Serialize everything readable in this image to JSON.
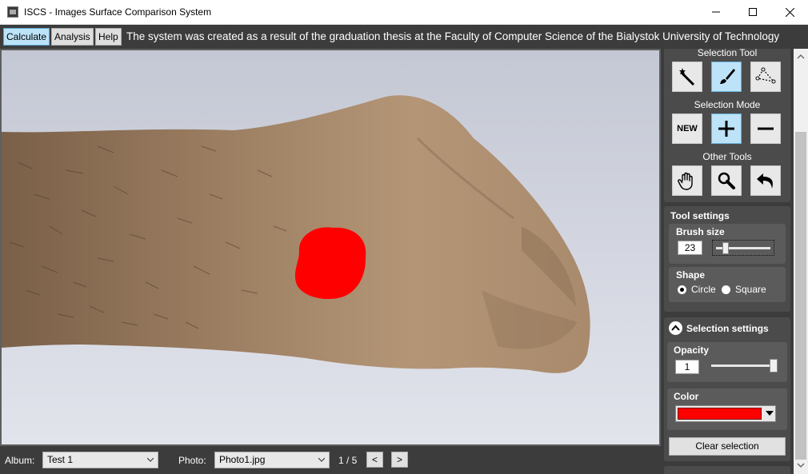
{
  "window": {
    "title": "ISCS - Images Surface Comparison System"
  },
  "menu": {
    "calculate_label": "Calculate",
    "analysis_label": "Analysis",
    "help_label": "Help",
    "info_text": "The system was created as a result of the graduation thesis at the Faculty of Computer Science of the Bialystok University of Technology"
  },
  "bottom": {
    "album_label": "Album:",
    "album_value": "Test 1",
    "photo_label": "Photo:",
    "photo_value": "Photo1.jpg",
    "page_indicator": "1 / 5",
    "prev_label": "<",
    "next_label": ">"
  },
  "side": {
    "selection_tool_label": "Selection Tool",
    "selection_mode_label": "Selection Mode",
    "other_tools_label": "Other Tools",
    "new_label": "NEW",
    "tool_settings_label": "Tool settings",
    "brush_size_label": "Brush size",
    "brush_size_value": "23",
    "shape_label": "Shape",
    "circle_label": "Circle",
    "square_label": "Square",
    "selection_settings_label": "Selection settings",
    "opacity_label": "Opacity",
    "opacity_value": "1",
    "color_label": "Color",
    "clear_selection_label": "Clear selection"
  },
  "state": {
    "active_tool": "brush",
    "active_mode": "add",
    "shape": "circle",
    "selection_color": "#ff0000"
  },
  "colors": {
    "panel_bg": "#3c3c3c",
    "selected_button": "#bde3f8",
    "selection_color": "#ff0000"
  }
}
